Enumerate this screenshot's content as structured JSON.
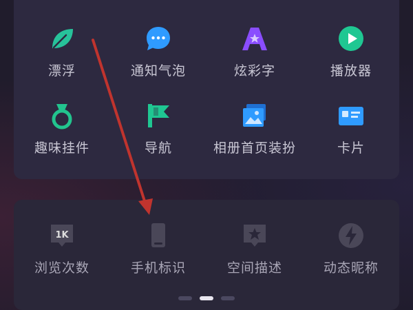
{
  "grid_top": [
    {
      "label": "漂浮",
      "icon": "leaf-icon",
      "color": "#27c29a"
    },
    {
      "label": "通知气泡",
      "icon": "chat-bubble-icon",
      "color": "#2f9bff"
    },
    {
      "label": "炫彩字",
      "icon": "letter-a-star-icon",
      "color": "#8a4dff"
    },
    {
      "label": "播放器",
      "icon": "play-circle-icon",
      "color": "#1fc792"
    },
    {
      "label": "趣味挂件",
      "icon": "medal-icon",
      "color": "#22c48e"
    },
    {
      "label": "导航",
      "icon": "flag-icon",
      "color": "#1fc792"
    },
    {
      "label": "相册首页装扮",
      "icon": "photo-album-icon",
      "color": "#2f9bff"
    },
    {
      "label": "卡片",
      "icon": "id-card-icon",
      "color": "#2f9bff"
    }
  ],
  "grid_bottom": [
    {
      "label": "浏览次数",
      "icon": "1k-badge-icon",
      "badge_text": "1K",
      "color": "#4a4758"
    },
    {
      "label": "手机标识",
      "icon": "phone-icon",
      "color": "#4a4758"
    },
    {
      "label": "空间描述",
      "icon": "star-bubble-icon",
      "color": "#4a4758"
    },
    {
      "label": "动态昵称",
      "icon": "lightning-circle-icon",
      "color": "#4a4758"
    }
  ],
  "pager": {
    "count": 3,
    "active": 1
  },
  "annotation": {
    "type": "arrow",
    "color": "#c0342e"
  }
}
